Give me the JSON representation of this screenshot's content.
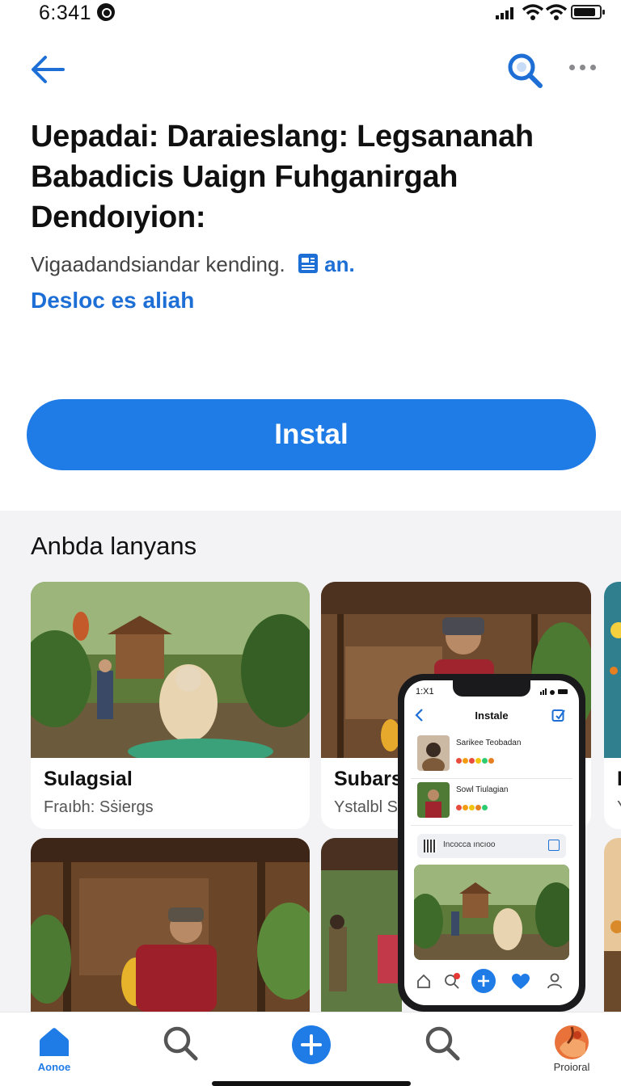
{
  "status_bar": {
    "time": "6:341"
  },
  "header": {
    "title": "Uepadai: Daraieslang: Legsananah Babadicis Uaign Fuhganirgah Dendoıyion:",
    "subtitle": "Vigaadandsiandar kending.",
    "subtitle_suffix": "an.",
    "link": "Desloc es aliah"
  },
  "install_button": {
    "label": "Instal"
  },
  "section": {
    "title": "Anbda lanyans",
    "cards": [
      {
        "name": "Sulagsial",
        "sub": "Fraıbh: Sṡiergs"
      },
      {
        "name": "Subars",
        "sub": "Ystalbl S"
      },
      {
        "name": "F",
        "sub": "Y"
      }
    ]
  },
  "phone_mockup": {
    "time": "1:X1",
    "title": "Instale",
    "rows": [
      {
        "name": "Sarikee Teobadan"
      },
      {
        "name": "Sowl Tiulagian"
      }
    ],
    "bar_text": "Incocca ıncıoo"
  },
  "tab_bar": {
    "home_label": "Aonoe",
    "profile_label": "Proioral"
  },
  "colors": {
    "accent": "#1f7be6",
    "link": "#1d6fd6"
  }
}
